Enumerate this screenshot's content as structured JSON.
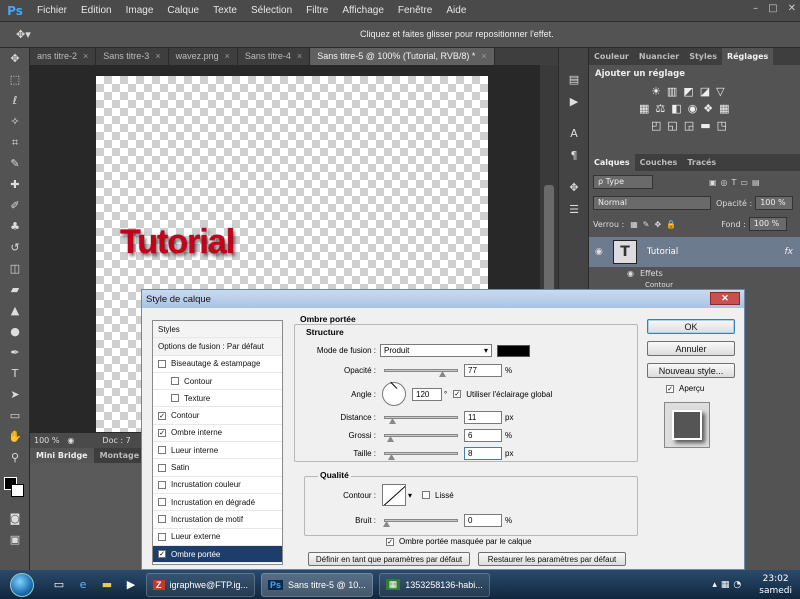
{
  "app": {
    "logo": "Ps",
    "menu": [
      "Fichier",
      "Edition",
      "Image",
      "Calque",
      "Texte",
      "Sélection",
      "Filtre",
      "Affichage",
      "Fenêtre",
      "Aide"
    ],
    "window_buttons": [
      "–",
      "□",
      "✕"
    ]
  },
  "options_bar": {
    "hint": "Cliquez et faites glisser pour repositionner l'effet."
  },
  "doc_tabs": [
    {
      "label": "ans titre-2",
      "active": false
    },
    {
      "label": "Sans titre-3",
      "active": false
    },
    {
      "label": "wavez.png",
      "active": false
    },
    {
      "label": "Sans titre-4",
      "active": false
    },
    {
      "label": "Sans titre-5 @ 100% (Tutorial, RVB/8) *",
      "active": true
    }
  ],
  "canvas": {
    "text": "Tutorial",
    "text_color": "#c4001a"
  },
  "status": {
    "zoom": "100 %",
    "doc": "Doc : 7"
  },
  "bottom_tabs": [
    "Mini Bridge",
    "Montage"
  ],
  "right_panel": {
    "top_tabs": [
      "Couleur",
      "Nuancier",
      "Styles",
      "Réglages"
    ],
    "adjust_title": "Ajouter un réglage",
    "layers_tabs": [
      "Calques",
      "Couches",
      "Tracés"
    ],
    "type_filter": "ρ Type",
    "blend_mode": "Normal",
    "opacity_label": "Opacité :",
    "opacity_value": "100 %",
    "lock_label": "Verrou :",
    "fill_label": "Fond :",
    "fill_value": "100 %",
    "layer_name": "Tutorial",
    "layer_effects": "Effets",
    "layer_sub": "Contour"
  },
  "dialog": {
    "title": "Style de calque",
    "close": "✕",
    "styles": [
      {
        "label": "Styles",
        "type": "head"
      },
      {
        "label": "Options de fusion : Par défaut",
        "type": "head"
      },
      {
        "label": "Biseautage & estampage",
        "checked": false
      },
      {
        "label": "Contour",
        "checked": false,
        "indent": true
      },
      {
        "label": "Texture",
        "checked": false,
        "indent": true
      },
      {
        "label": "Contour",
        "checked": true
      },
      {
        "label": "Ombre interne",
        "checked": true
      },
      {
        "label": "Lueur interne",
        "checked": false
      },
      {
        "label": "Satin",
        "checked": false
      },
      {
        "label": "Incrustation couleur",
        "checked": false
      },
      {
        "label": "Incrustation en dégradé",
        "checked": false
      },
      {
        "label": "Incrustation de motif",
        "checked": false
      },
      {
        "label": "Lueur externe",
        "checked": false
      },
      {
        "label": "Ombre portée",
        "checked": true,
        "selected": true
      }
    ],
    "section_title": "Ombre portée",
    "structure_title": "Structure",
    "blend_label": "Mode de fusion :",
    "blend_value": "Produit",
    "opacity_label": "Opacité :",
    "opacity_value": "77",
    "angle_label": "Angle :",
    "angle_value": "120",
    "global_light_label": "Utiliser l'éclairage global",
    "distance_label": "Distance :",
    "distance_value": "11",
    "spread_label": "Grossi :",
    "spread_value": "6",
    "size_label": "Taille :",
    "size_value": "8",
    "quality_title": "Qualité",
    "contour_label": "Contour :",
    "antialias_label": "Lissé",
    "noise_label": "Bruit :",
    "noise_value": "0",
    "knockout_label": "Ombre portée masquée par le calque",
    "default_btn": "Définir en tant que paramètres par défaut",
    "reset_btn": "Restaurer les paramètres par défaut",
    "ok": "OK",
    "cancel": "Annuler",
    "new_style": "Nouveau style...",
    "preview": "Aperçu",
    "unit_pct": "%",
    "unit_px": "px",
    "unit_deg": "°"
  },
  "taskbar": {
    "tasks": [
      {
        "label": "igraphwe@FTP.ig...",
        "active": false
      },
      {
        "label": "Sans titre-5 @ 10...",
        "active": true
      },
      {
        "label": "1353258136-habi...",
        "active": false
      }
    ],
    "time": "23:02",
    "day": "samedi"
  }
}
